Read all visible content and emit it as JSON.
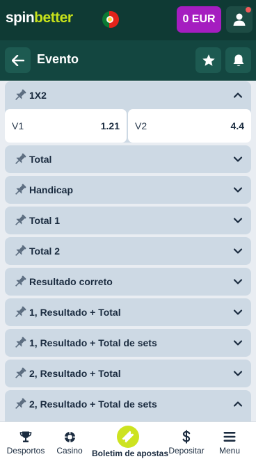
{
  "header": {
    "logo_part1": "spin",
    "logo_part2": "better",
    "flag_icon": "portugal-flag-icon",
    "balance": "0 EUR",
    "profile_icon": "user-icon",
    "colors": {
      "bg": "#0f3a34",
      "balance": "#a51dc0",
      "logo_accent": "#c7e21b"
    }
  },
  "subheader": {
    "back_icon": "arrow-left-icon",
    "title": "Evento",
    "favorite_icon": "star-icon",
    "notifications_icon": "bell-icon"
  },
  "markets": [
    {
      "label": "1X2",
      "expanded": true,
      "odds": [
        {
          "label": "V1",
          "value": "1.21"
        },
        {
          "label": "V2",
          "value": "4.4"
        }
      ]
    },
    {
      "label": "Total",
      "expanded": false
    },
    {
      "label": "Handicap",
      "expanded": false
    },
    {
      "label": "Total 1",
      "expanded": false
    },
    {
      "label": "Total 2",
      "expanded": false
    },
    {
      "label": "Resultado correto",
      "expanded": false
    },
    {
      "label": "1, Resultado + Total",
      "expanded": false
    },
    {
      "label": "1, Resultado + Total de sets",
      "expanded": false
    },
    {
      "label": "2, Resultado + Total",
      "expanded": false
    },
    {
      "label": "2, Resultado + Total de sets",
      "expanded": true
    }
  ],
  "bottom_nav": {
    "sports": {
      "label": "Desportos",
      "icon": "trophy-icon"
    },
    "casino": {
      "label": "Casino",
      "icon": "casino-chip-icon"
    },
    "betslip": {
      "label": "Boletim de apostas",
      "icon": "ticket-icon"
    },
    "deposit": {
      "label": "Depositar",
      "icon": "dollar-icon"
    },
    "menu": {
      "label": "Menu",
      "icon": "hamburger-menu-icon"
    }
  }
}
